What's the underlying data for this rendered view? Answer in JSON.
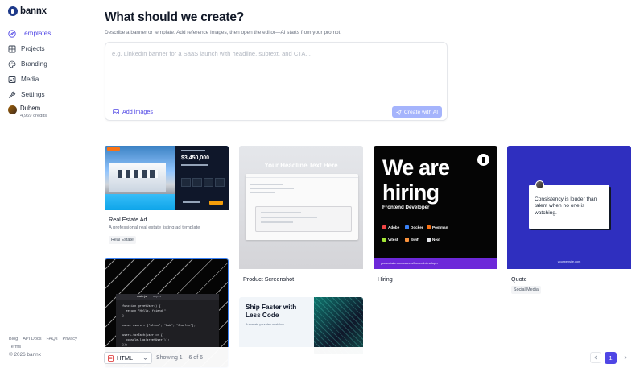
{
  "brand": {
    "name": "bannx"
  },
  "sidebar": {
    "items": [
      {
        "label": "Templates",
        "icon": "compass-icon",
        "active": true
      },
      {
        "label": "Projects",
        "icon": "grid-icon",
        "active": false
      },
      {
        "label": "Branding",
        "icon": "palette-icon",
        "active": false
      },
      {
        "label": "Media",
        "icon": "image-icon",
        "active": false
      },
      {
        "label": "Settings",
        "icon": "wrench-icon",
        "active": false
      }
    ],
    "user": {
      "name": "Dubem",
      "credits": "4,969 credits"
    },
    "footer_links": [
      "Blog",
      "API Docs",
      "FAQs",
      "Privacy",
      "Terms"
    ],
    "copyright": "© 2026 bannx"
  },
  "main": {
    "title": "What should we create?",
    "subtitle": "Describe a banner or template. Add reference images, then open the editor—AI starts from your prompt.",
    "prompt": {
      "placeholder": "e.g. LinkedIn banner for a SaaS launch with headline, subtext, and CTA...",
      "value": "",
      "add_images_label": "Add images",
      "create_label": "Create with AI"
    }
  },
  "templates": [
    {
      "name": "Real Estate Ad",
      "description": "A professional real estate listing ad template",
      "tag": "Real Estate",
      "thumb": {
        "price": "$3,450,000"
      }
    },
    {
      "name": "Product Screenshot",
      "description": "",
      "tag": "",
      "thumb": {
        "headline": "Your Headline Text Here"
      }
    },
    {
      "name": "Hiring",
      "description": "",
      "tag": "",
      "thumb": {
        "headline": "We are hiring",
        "role": "Frontend Developer",
        "stack": [
          "Adobe",
          "Docker",
          "Postman",
          "Vitest",
          "Swift",
          "Next"
        ],
        "url": "yourwebsite.com/careers/frontend-developer"
      }
    },
    {
      "name": "Quote",
      "description": "",
      "tag": "Social Media",
      "thumb": {
        "quote": "Consistency is louder than talent when no one is watching.",
        "url": "yourwebsite.com"
      }
    },
    {
      "name": "",
      "description": "",
      "tag": "",
      "thumb": {
        "tabs": [
          "main.js",
          "app.js"
        ],
        "code": "function greetUser() {\n  return \"Hello, friend!\";\n}\n\nconst users = [\"Alice\", \"Bob\", \"Charlie\"];\n\nusers.forEach(user => {\n  console.log(greetUser());\n});"
      }
    },
    {
      "name": "",
      "description": "",
      "tag": "",
      "thumb": {
        "headline": "Ship Faster with Less Code",
        "subtext": "Automate your dev workflow"
      }
    }
  ],
  "bottom_bar": {
    "format": "HTML",
    "showing": "Showing 1 – 6 of 6",
    "current_page": "1"
  },
  "colors": {
    "accent": "#4f46e5",
    "accent_light": "#a5b4fc",
    "hiring_bar": "#6d28d9",
    "quote_bg": "#2f2fbf"
  }
}
